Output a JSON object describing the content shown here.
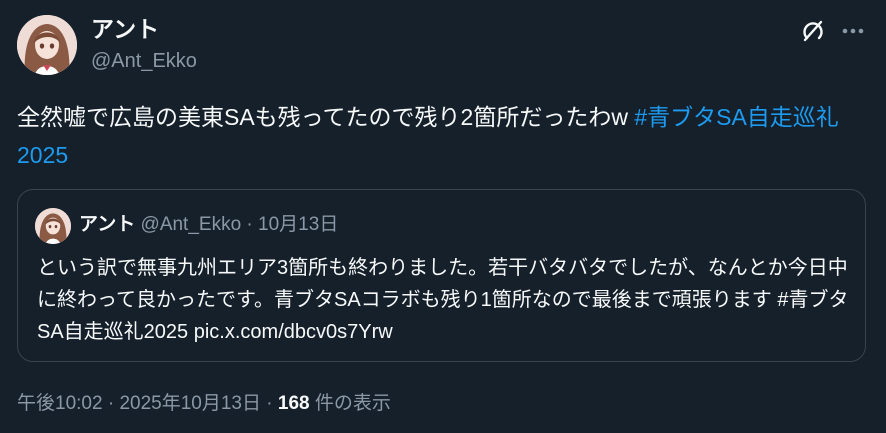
{
  "author": {
    "name": "アント",
    "handle": "@Ant_Ekko"
  },
  "icons": {
    "grok": "grok-icon",
    "more": "more-icon"
  },
  "tweet": {
    "text": "全然嘘で広島の美東SAも残ってたので残り2箇所だったわw ",
    "hashtag": "#青ブタSA自走巡礼2025"
  },
  "quote": {
    "name": "アント",
    "handle": "@Ant_Ekko",
    "separator": " · ",
    "date": "10月13日",
    "text": "という訳で無事九州エリア3箇所も終わりました。若干バタバタでしたが、なんとか今日中に終わって良かったです。青ブタSAコラボも残り1箇所なので最後まで頑張ります #青ブタSA自走巡礼2025 pic.x.com/dbcv0s7Yrw"
  },
  "footer": {
    "time": "午後10:02",
    "sep1": " · ",
    "date": "2025年10月13日",
    "sep2": " · ",
    "views": "168",
    "views_label": " 件の表示"
  },
  "colors": {
    "background": "#15202b",
    "text": "#f7f9f9",
    "secondary": "#8b98a5",
    "link": "#1d9bf0",
    "border": "#38444d"
  }
}
